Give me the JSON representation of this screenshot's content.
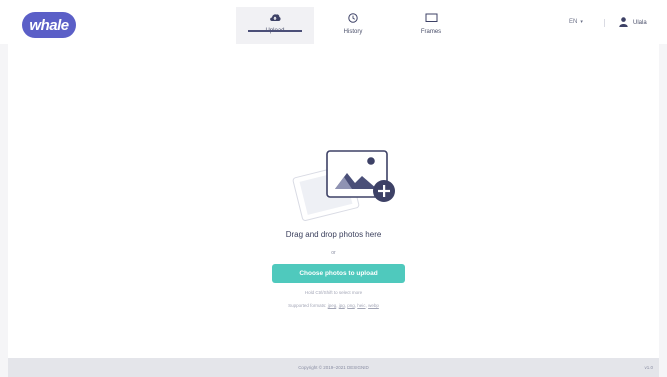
{
  "header": {
    "logo_text": "whale",
    "tabs": [
      {
        "label": "Upload",
        "icon": "cloud-upload-icon",
        "active": true
      },
      {
        "label": "History",
        "icon": "clock-icon",
        "active": false
      },
      {
        "label": "Frames",
        "icon": "frame-icon",
        "active": false
      }
    ],
    "language": "EN",
    "user_name": "Ulala"
  },
  "upload": {
    "drag_text": "Drag and drop photos here",
    "or_text": "or",
    "button_label": "Choose photos to upload",
    "hint": "Hold Ctrl/Shift to select more",
    "formats_label": "Supported formats:",
    "formats": [
      "jpeg",
      "jpg",
      "png",
      "heic",
      "webp"
    ]
  },
  "footer": {
    "copyright": "Copyright © 2019–2021 DESIGNID",
    "version": "v1.0"
  },
  "colors": {
    "brand": "#5b5fc7",
    "accent": "#4fc9bd",
    "text_dark": "#3a3f5c"
  }
}
